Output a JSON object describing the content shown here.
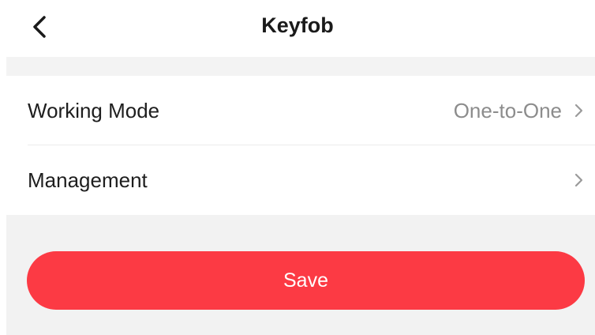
{
  "header": {
    "title": "Keyfob",
    "back_icon": "chevron-left-icon"
  },
  "settings": {
    "rows": [
      {
        "label": "Working Mode",
        "value": "One-to-One",
        "icon": "chevron-right-icon"
      },
      {
        "label": "Management",
        "value": "",
        "icon": "chevron-right-icon"
      }
    ]
  },
  "actions": {
    "save_label": "Save"
  },
  "colors": {
    "accent": "#fc3a44",
    "background_gray": "#f2f2f2",
    "value_text": "#8c8c8c",
    "chevron": "#9a9a9a"
  }
}
